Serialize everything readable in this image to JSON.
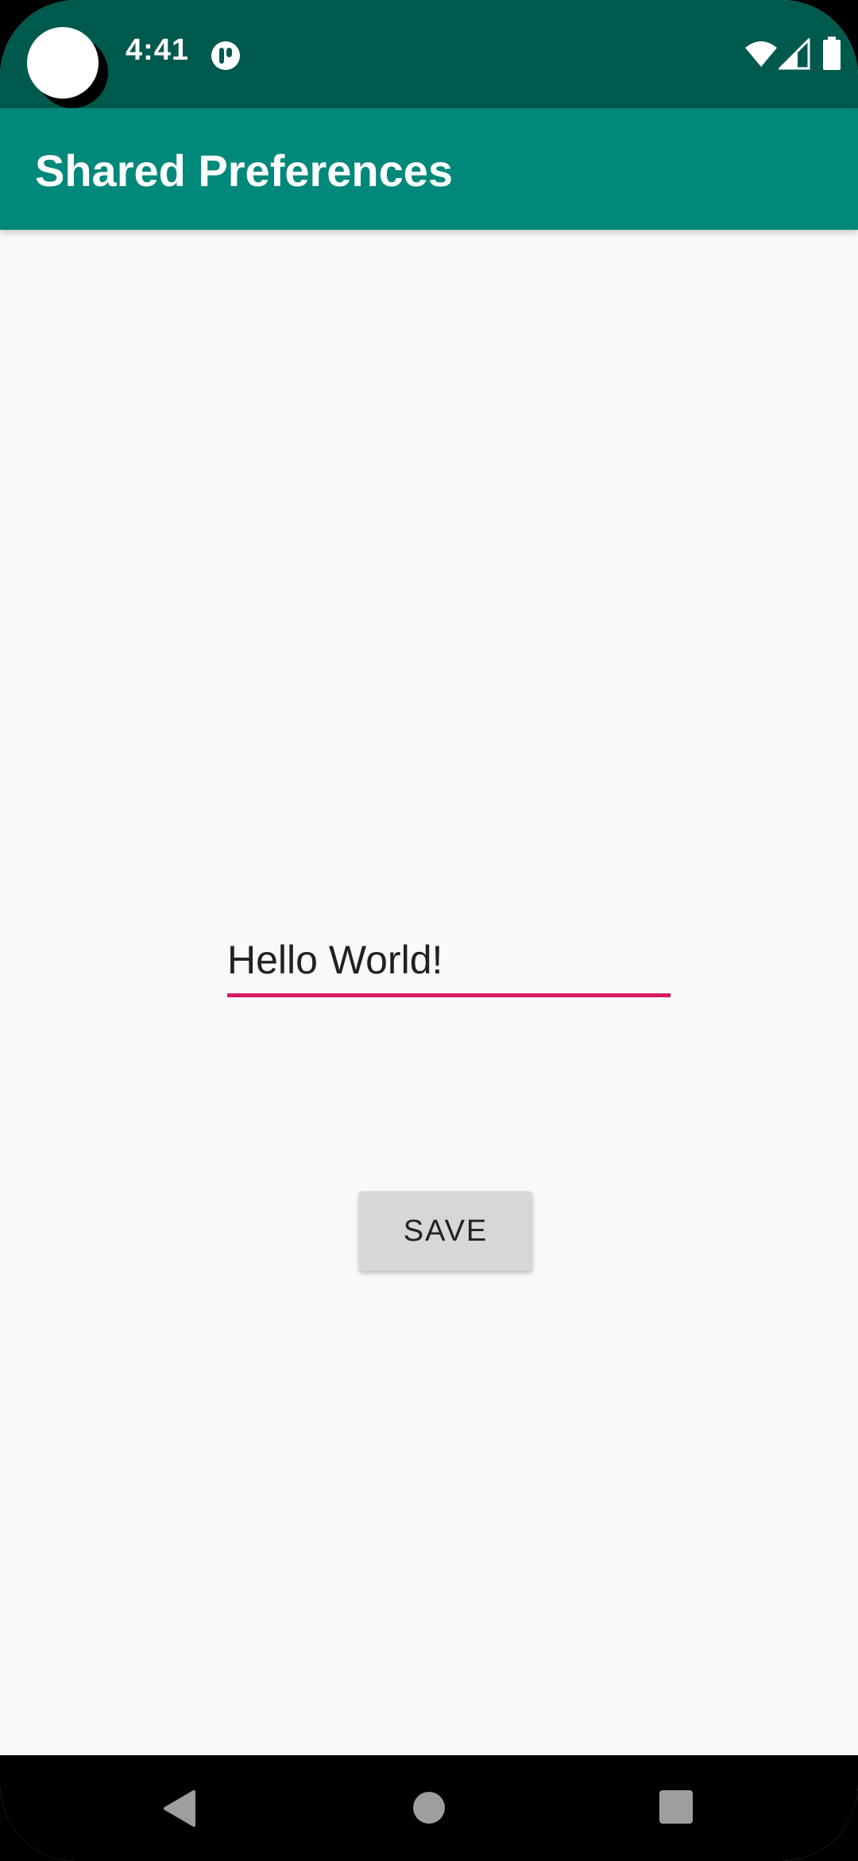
{
  "status_bar": {
    "time": "4:41",
    "icons": [
      "notification-icon",
      "wifi-icon",
      "signal-icon",
      "battery-icon"
    ],
    "background_color": "#00594d"
  },
  "app_bar": {
    "title": "Shared Preferences",
    "background_color": "#00887a"
  },
  "main": {
    "edit_text": {
      "value": "Hello World!",
      "underline_color": "#d81b60"
    },
    "save_button": {
      "label": "SAVE"
    }
  },
  "nav_bar": {
    "buttons": [
      "back-icon",
      "home-icon",
      "recents-icon"
    ]
  }
}
